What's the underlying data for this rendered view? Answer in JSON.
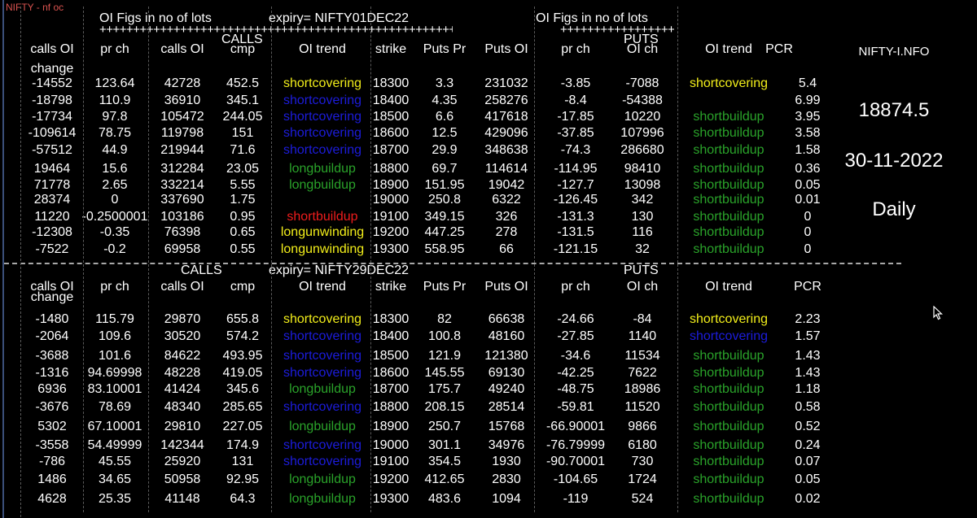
{
  "window": {
    "title": "NIFTY - nf oc"
  },
  "colors": {
    "shortcovering_yellow": "#f2ee1a",
    "shortcovering_blue": "#1c1cdc",
    "longbuildup": "#2aa32a",
    "shortbuildup_red": "#ee1c1c",
    "shortbuildup_green": "#2aa32a",
    "longunwinding": "#f2ee1a"
  },
  "section1": {
    "oi_figs_left": "OI Figs in no of lots",
    "expiry": "expiry=  NIFTY01DEC22",
    "oi_figs_right": "OI Figs in no of lots",
    "plus_left": "++++++++++++++++++++++++++++++++++++++++++++++++++++++++",
    "plus_right": "+++++++++++++++++",
    "calls": "CALLS",
    "puts": "PUTS",
    "headers": {
      "calls_oi": "calls OI",
      "change": "change",
      "pr_ch": "pr ch",
      "calls_oi2": "calls OI",
      "cmp": "cmp",
      "oi_trend": "OI trend",
      "strike": "strike",
      "puts_pr": "Puts Pr",
      "puts_oi": "Puts OI",
      "pr_ch2": "pr ch",
      "oi_ch": "OI ch",
      "oi_trend2": "OI trend",
      "pcr": "PCR"
    },
    "rows": [
      [
        "-14552",
        "123.64",
        "42728",
        "452.5",
        "shortcovering",
        "18300",
        "3.3",
        "231032",
        "-3.85",
        "-7088",
        "shortcovering",
        "5.4"
      ],
      [
        "-18798",
        "110.9",
        "36910",
        "345.1",
        "shortcovering",
        "18400",
        "4.35",
        "258276",
        "-8.4",
        "-54388",
        "",
        "6.99"
      ],
      [
        "-17734",
        "97.8",
        "105472",
        "244.05",
        "shortcovering",
        "18500",
        "6.6",
        "417618",
        "-17.85",
        "10220",
        "shortbuildup",
        "3.95"
      ],
      [
        "-109614",
        "78.75",
        "119798",
        "151",
        "shortcovering",
        "18600",
        "12.5",
        "429096",
        "-37.85",
        "107996",
        "shortbuildup",
        "3.58"
      ],
      [
        "-57512",
        "44.9",
        "219944",
        "71.6",
        "shortcovering",
        "18700",
        "29.9",
        "348638",
        "-74.3",
        "286680",
        "shortbuildup",
        "1.58"
      ],
      [
        "19464",
        "15.6",
        "312284",
        "23.05",
        "longbuildup",
        "18800",
        "69.7",
        "114614",
        "-114.95",
        "98410",
        "shortbuildup",
        "0.36"
      ],
      [
        "71778",
        "2.65",
        "332214",
        "5.55",
        "longbuildup",
        "18900",
        "151.95",
        "19042",
        "-127.7",
        "13098",
        "shortbuildup",
        "0.05"
      ],
      [
        "28374",
        "0",
        "337690",
        "1.75",
        "",
        "19000",
        "250.8",
        "6322",
        "-126.45",
        "342",
        "shortbuildup",
        "0.01"
      ],
      [
        "11220",
        "-0.2500001",
        "103186",
        "0.95",
        "shortbuildup",
        "19100",
        "349.15",
        "326",
        "-131.3",
        "130",
        "shortbuildup",
        "0"
      ],
      [
        "-12308",
        "-0.35",
        "76398",
        "0.65",
        "longunwinding",
        "19200",
        "447.25",
        "278",
        "-131.5",
        "116",
        "shortbuildup",
        "0"
      ],
      [
        "-7522",
        "-0.2",
        "69958",
        "0.55",
        "longunwinding",
        "19300",
        "558.95",
        "66",
        "-121.15",
        "32",
        "shortbuildup",
        "0"
      ]
    ],
    "trend_colors_left": [
      "#f2ee1a",
      "#1c1cdc",
      "#1c1cdc",
      "#1c1cdc",
      "#1c1cdc",
      "#2aa32a",
      "#2aa32a",
      "#ffffff",
      "#ee1c1c",
      "#f2ee1a",
      "#f2ee1a"
    ],
    "trend_colors_right": [
      "#f2ee1a",
      "#ffffff",
      "#2aa32a",
      "#2aa32a",
      "#2aa32a",
      "#2aa32a",
      "#2aa32a",
      "#2aa32a",
      "#2aa32a",
      "#2aa32a",
      "#2aa32a"
    ]
  },
  "section2": {
    "calls": "CALLS",
    "expiry": "expiry=  NIFTY29DEC22",
    "puts": "PUTS",
    "headers": {
      "calls_oi": "calls OI",
      "change": "change",
      "pr_ch": "pr ch",
      "calls_oi2": "calls OI",
      "cmp": "cmp",
      "oi_trend": "OI trend",
      "strike": "strike",
      "puts_pr": "Puts Pr",
      "puts_oi": "Puts OI",
      "pr_ch2": "pr ch",
      "oi_ch": "OI ch",
      "oi_trend2": "OI trend",
      "pcr": "PCR"
    },
    "rows": [
      [
        "-1480",
        "115.79",
        "29870",
        "655.8",
        "shortcovering",
        "18300",
        "82",
        "66638",
        "-24.66",
        "-84",
        "shortcovering",
        "2.23"
      ],
      [
        "-2064",
        "109.6",
        "30520",
        "574.2",
        "shortcovering",
        "18400",
        "100.8",
        "48160",
        "-27.85",
        "1140",
        "shortcovering",
        "1.57"
      ],
      [
        "-3688",
        "101.6",
        "84622",
        "493.95",
        "shortcovering",
        "18500",
        "121.9",
        "121380",
        "-34.6",
        "11534",
        "shortbuildup",
        "1.43"
      ],
      [
        "-1316",
        "94.69998",
        "48228",
        "419.05",
        "shortcovering",
        "18600",
        "145.55",
        "69130",
        "-42.25",
        "7622",
        "shortbuildup",
        "1.43"
      ],
      [
        "6936",
        "83.10001",
        "41424",
        "345.6",
        "longbuildup",
        "18700",
        "175.7",
        "49240",
        "-48.75",
        "18986",
        "shortbuildup",
        "1.18"
      ],
      [
        "-3676",
        "78.69",
        "48340",
        "285.65",
        "shortcovering",
        "18800",
        "208.15",
        "28514",
        "-59.81",
        "11520",
        "shortbuildup",
        "0.58"
      ],
      [
        "5302",
        "67.10001",
        "29810",
        "227.05",
        "longbuildup",
        "18900",
        "250.7",
        "15768",
        "-66.90001",
        "9866",
        "shortbuildup",
        "0.52"
      ],
      [
        "-3558",
        "54.49999",
        "142344",
        "174.9",
        "shortcovering",
        "19000",
        "301.1",
        "34976",
        "-76.79999",
        "6180",
        "shortbuildup",
        "0.24"
      ],
      [
        "-786",
        "45.55",
        "25920",
        "131",
        "shortcovering",
        "19100",
        "354.5",
        "1930",
        "-90.70001",
        "730",
        "shortbuildup",
        "0.07"
      ],
      [
        "1486",
        "34.65",
        "50958",
        "92.95",
        "longbuildup",
        "19200",
        "412.65",
        "2830",
        "-104.65",
        "1724",
        "shortbuildup",
        "0.05"
      ],
      [
        "4628",
        "25.35",
        "41148",
        "64.3",
        "longbuildup",
        "19300",
        "483.6",
        "1094",
        "-119",
        "524",
        "shortbuildup",
        "0.02"
      ]
    ],
    "trend_colors_left": [
      "#f2ee1a",
      "#1c1cdc",
      "#1c1cdc",
      "#1c1cdc",
      "#2aa32a",
      "#1c1cdc",
      "#2aa32a",
      "#1c1cdc",
      "#1c1cdc",
      "#2aa32a",
      "#2aa32a"
    ],
    "trend_colors_right": [
      "#f2ee1a",
      "#1c1cdc",
      "#2aa32a",
      "#2aa32a",
      "#2aa32a",
      "#2aa32a",
      "#2aa32a",
      "#2aa32a",
      "#2aa32a",
      "#2aa32a",
      "#2aa32a"
    ]
  },
  "side_panel": {
    "symbol": "NIFTY-I.NFO",
    "price": "18874.5",
    "date": "30-11-2022",
    "period": "Daily"
  },
  "cursor": {
    "icon": "mouse-pointer-icon"
  }
}
